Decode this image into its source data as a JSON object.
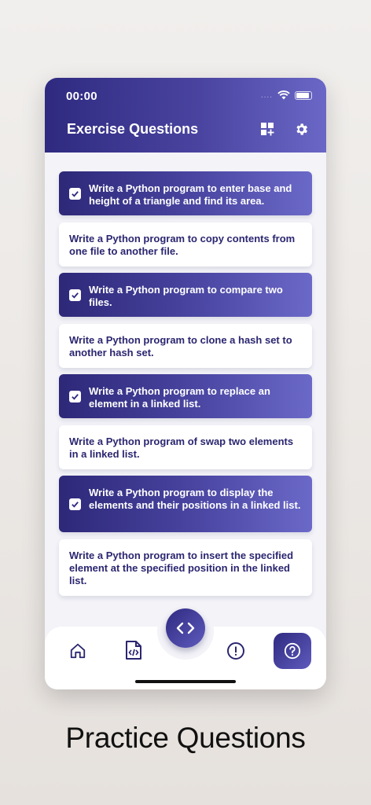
{
  "status_bar": {
    "time": "00:00",
    "signal": "....",
    "wifi_icon": "wifi-icon",
    "battery_icon": "battery-icon"
  },
  "header": {
    "title": "Exercise Questions",
    "grid_add_icon": "grid-add-icon",
    "settings_icon": "gear-icon"
  },
  "questions": [
    {
      "text": "Write a Python  program to enter base and height of a triangle and find its area.",
      "checked": true
    },
    {
      "text": "Write a Python  program to copy contents from one file to another file.",
      "checked": false
    },
    {
      "text": "Write a Python program to compare two files.",
      "checked": true
    },
    {
      "text": "Write a Python program to clone a hash set to another hash set.",
      "checked": false
    },
    {
      "text": "Write a Python program to replace an element in a linked list.",
      "checked": true
    },
    {
      "text": "Write a Python program of swap two elements in a linked list.",
      "checked": false
    },
    {
      "text": "Write a Python program to display the elements and their positions in a linked list.",
      "checked": true
    },
    {
      "text": "Write a Python program to insert the specified element at the specified position in the linked list.",
      "checked": false
    }
  ],
  "bottom_nav": {
    "items": [
      "home-icon",
      "code-file-icon",
      "code-icon",
      "alert-icon",
      "help-icon"
    ],
    "active": "help-icon"
  },
  "colors": {
    "primary_dark": "#2f2a80",
    "primary_light": "#6a67c6",
    "card_text": "#2b2670"
  },
  "caption": "Practice Questions"
}
